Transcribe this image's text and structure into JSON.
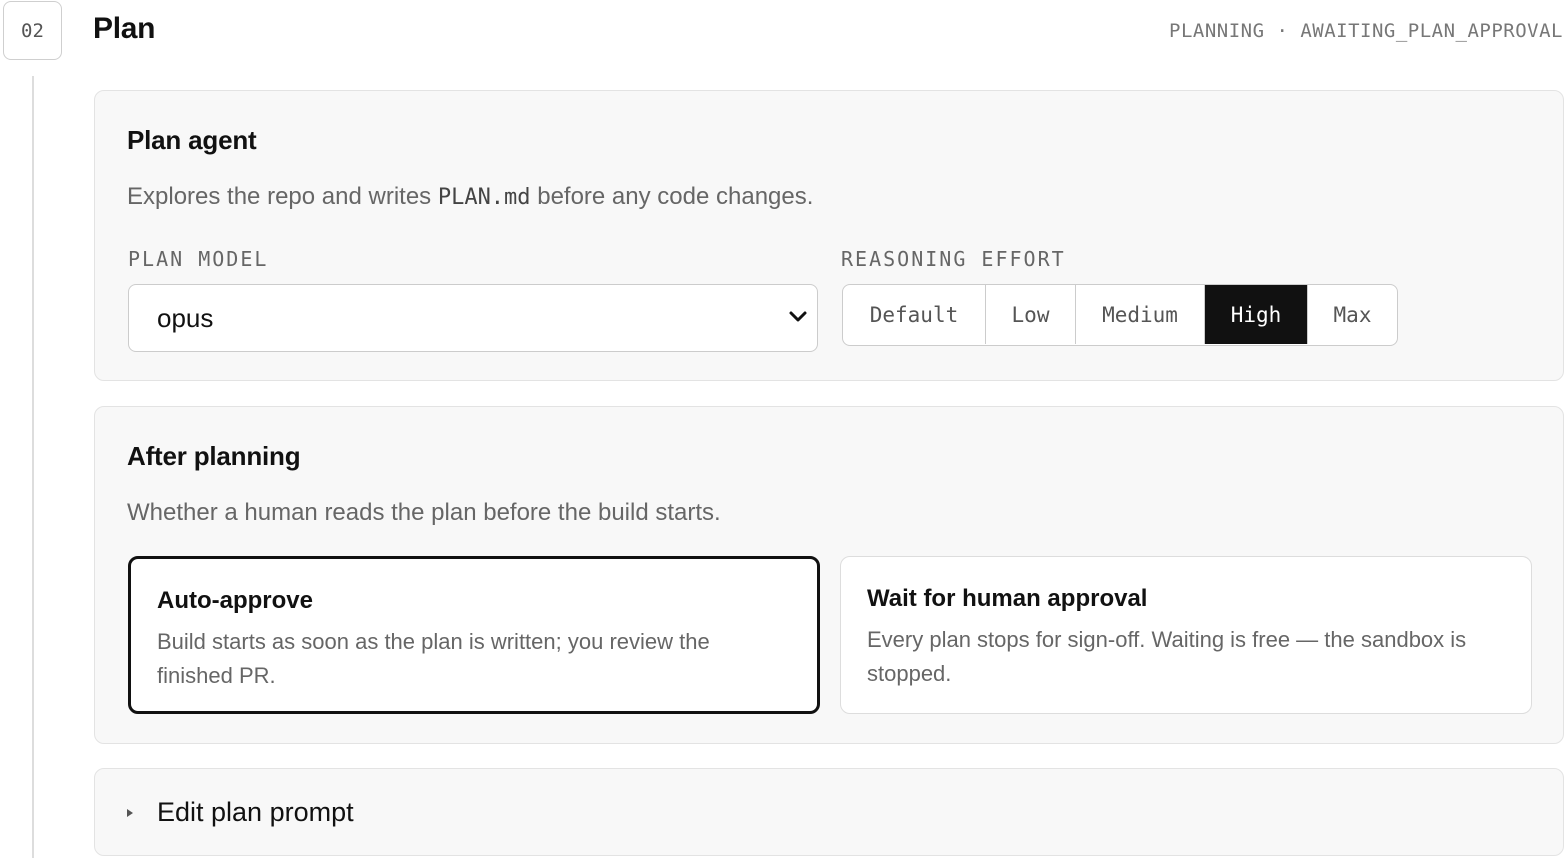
{
  "step": {
    "number": "02",
    "title": "Plan",
    "status": "PLANNING · AWAITING_PLAN_APPROVAL"
  },
  "plan_agent": {
    "title": "Plan agent",
    "desc_before": "Explores the repo and writes ",
    "desc_code": "PLAN.md",
    "desc_after": " before any code changes.",
    "model_label": "PLAN MODEL",
    "model_value": "opus",
    "effort_label": "REASONING EFFORT",
    "effort_options": [
      "Default",
      "Low",
      "Medium",
      "High",
      "Max"
    ],
    "effort_selected": "High"
  },
  "after_planning": {
    "title": "After planning",
    "desc": "Whether a human reads the plan before the build starts.",
    "options": [
      {
        "title": "Auto-approve",
        "desc": "Build starts as soon as the plan is written; you review the finished PR.",
        "selected": true
      },
      {
        "title": "Wait for human approval",
        "desc": "Every plan stops for sign-off. Waiting is free — the sandbox is stopped.",
        "selected": false
      }
    ]
  },
  "prompt_editor": {
    "label": "Edit plan prompt"
  },
  "icons": {
    "dropdown": "chevron-down-icon",
    "disclosure": "triangle-right-icon"
  },
  "colors": {
    "accent": "#111111",
    "muted_text": "#666666",
    "card_bg": "#f8f8f8"
  }
}
